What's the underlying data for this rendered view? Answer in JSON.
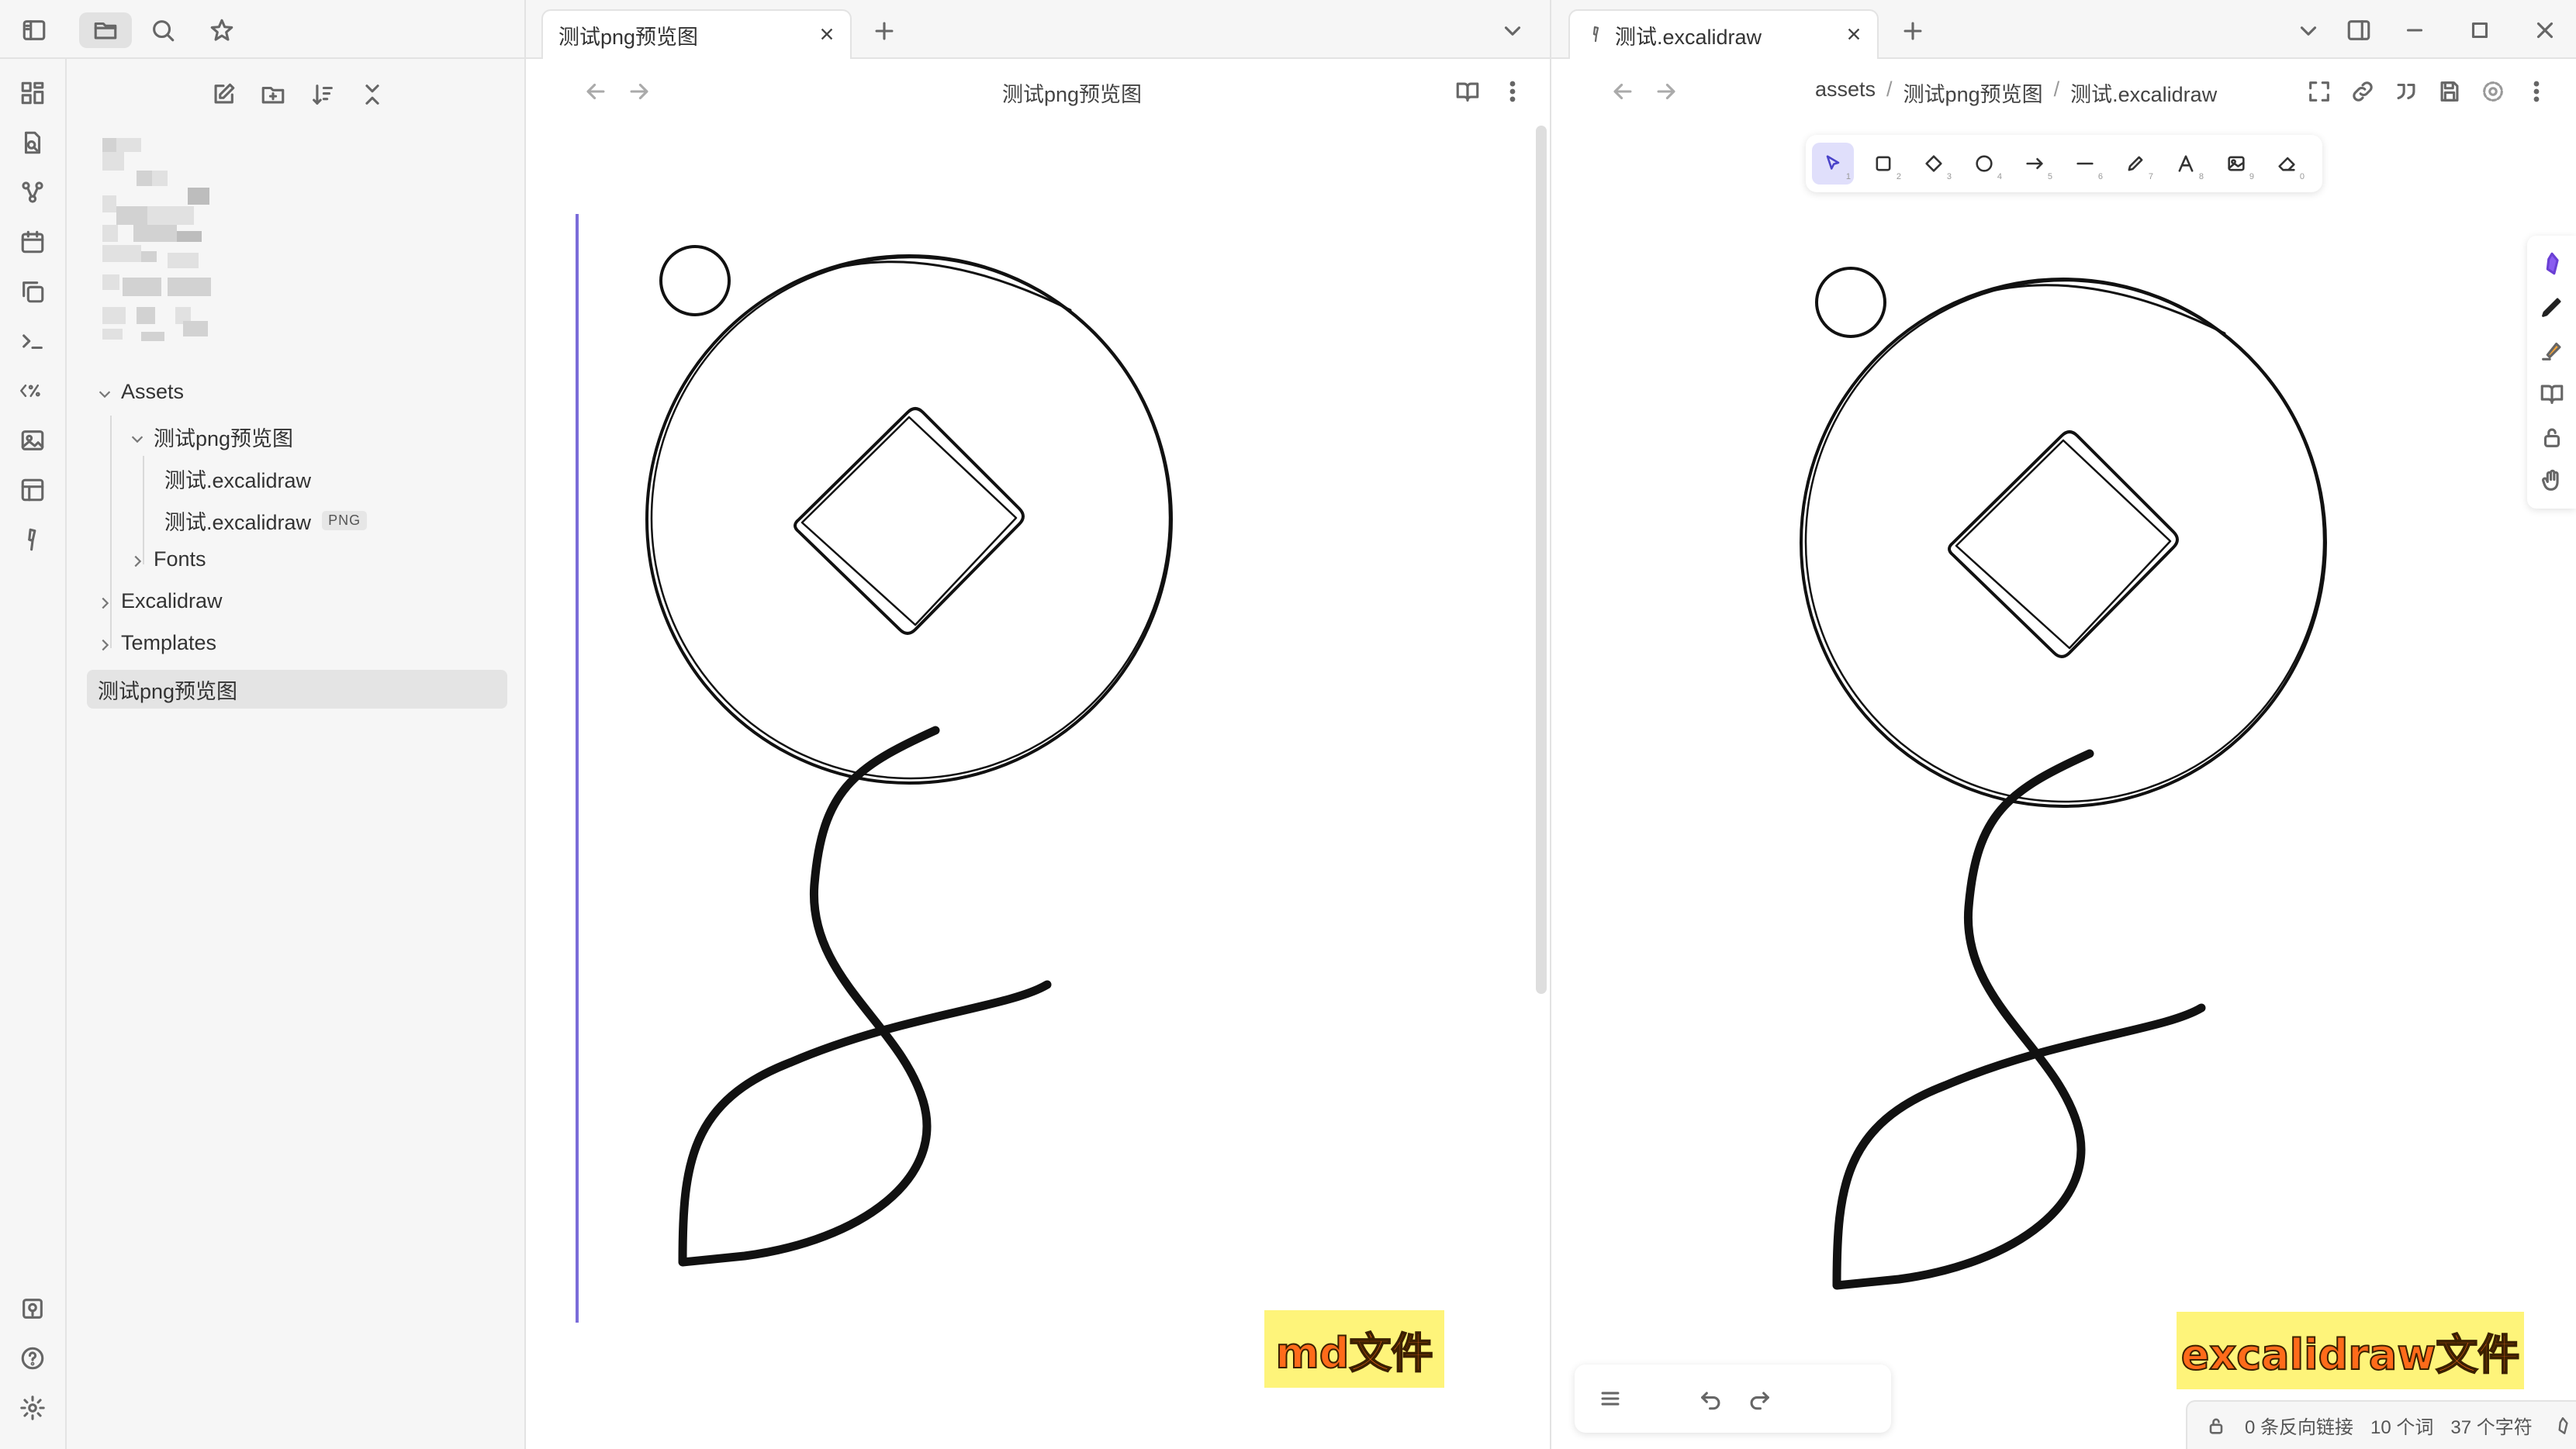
{
  "sidebar": {
    "tree": {
      "assets_folder": "Assets",
      "subfolder": "测试png预览图",
      "file1": "测试.excalidraw",
      "file2": "测试.excalidraw",
      "file2_badge": "PNG",
      "fonts_folder": "Fonts",
      "excalidraw_folder": "Excalidraw",
      "templates_folder": "Templates",
      "selected_note": "测试png预览图"
    }
  },
  "left_pane": {
    "tab_title": "测试png预览图",
    "view_title": "测试png预览图",
    "overlay_label": "md文件"
  },
  "right_pane": {
    "tab_title": "测试.excalidraw",
    "breadcrumb": [
      "assets",
      "/",
      "测试png预览图",
      "/",
      "测试.excalidraw"
    ],
    "overlay_label": "excalidraw文件",
    "toolbar_keys": [
      "1",
      "2",
      "3",
      "4",
      "5",
      "6",
      "7",
      "8",
      "9",
      "0"
    ],
    "status": {
      "backlinks": "0 条反向链接",
      "words": "10 个词",
      "chars": "37 个字符"
    }
  },
  "colors": {
    "accent": "#7b6cd9",
    "label_bg": "#fef47a",
    "label_text": "#ff6b1a"
  }
}
